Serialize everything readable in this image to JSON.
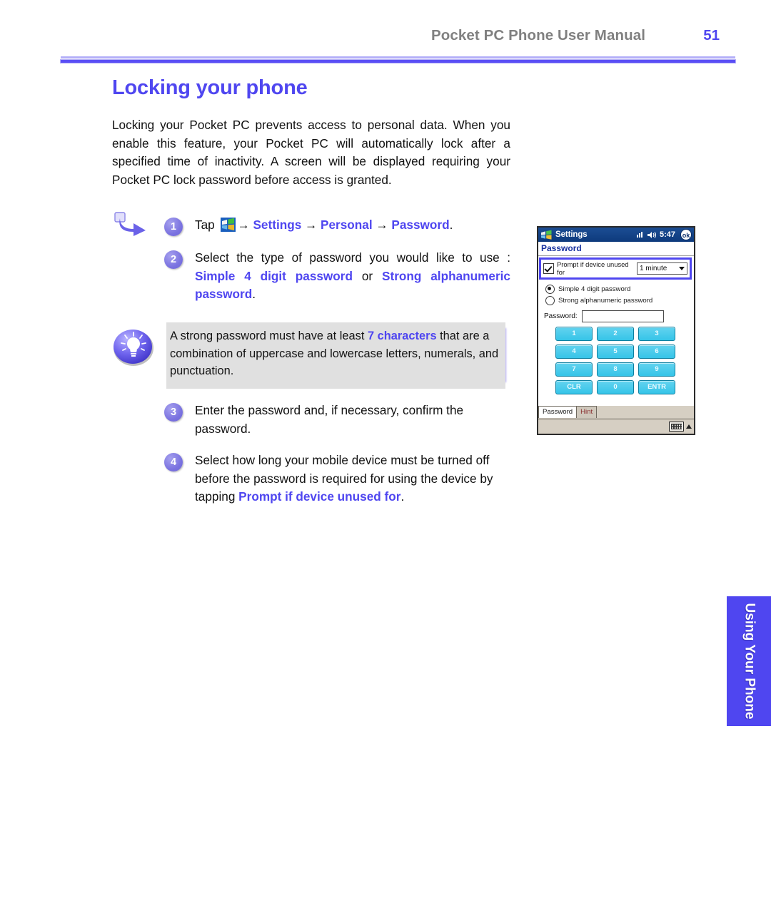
{
  "header": {
    "title": "Pocket PC Phone User Manual",
    "page_number": "51",
    "accent_color": "#4f46f0",
    "title_color": "#808080"
  },
  "document": {
    "title": "Locking your phone",
    "intro": "Locking your Pocket PC prevents access to personal data. When you enable this feature, your Pocket PC will automatically lock after a specified time of inactivity. A screen will be displayed requiring your Pocket PC lock password before access is granted."
  },
  "steps": [
    {
      "number": "1",
      "text_prefix": "Tap ",
      "icon": "windows-start-logo",
      "arrow1": "→ ",
      "link1": "Settings",
      "arrow2": " → ",
      "link2": "Personal",
      "arrow3": " → ",
      "link3": "Password",
      "text_suffix": "."
    },
    {
      "number": "2",
      "text_prefix": "Select the type of password you would like to use : ",
      "link1": "Simple 4 digit password",
      "mid": " or ",
      "link2": "Strong alphanumeric password",
      "text_suffix": "."
    },
    {
      "number": "3",
      "text_prefix": "Enter the password and, if necessary, confirm the password."
    },
    {
      "number": "4",
      "text_prefix": "Select  how long your mobile device must be turned off before the password is required for using the device by tapping ",
      "link1": "Prompt if device unused for",
      "text_suffix": "."
    }
  ],
  "tip": {
    "icon": "lightbulb-icon",
    "text_before": "A strong password must have at least ",
    "highlight": "7 characters",
    "text_after": " that are a combination of uppercase and lowercase letters, numerals, and punctuation.",
    "background_color": "#e0e0e0",
    "shadow_color": "#b0a8f6"
  },
  "pda": {
    "titlebar": {
      "app_name": "Settings",
      "clock": "5:47",
      "ok_label": "ok",
      "icons": [
        "start-logo-icon",
        "connectivity-icon",
        "volume-icon"
      ]
    },
    "subtitle": "Password",
    "prompt_row": {
      "checkbox_checked": true,
      "label": "Prompt if device unused for",
      "dropdown_value": "1 minute",
      "highlight_border_color": "#4f46f0"
    },
    "radios": [
      {
        "label": "Simple 4 digit password",
        "checked": true
      },
      {
        "label": "Strong alphanumeric password",
        "checked": false
      }
    ],
    "password_field": {
      "label": "Password:",
      "value": ""
    },
    "keypad": [
      "1",
      "2",
      "3",
      "4",
      "5",
      "6",
      "7",
      "8",
      "9",
      "CLR",
      "0",
      "ENTR"
    ],
    "tabs": [
      {
        "label": "Password",
        "active": true
      },
      {
        "label": "Hint",
        "active": false
      }
    ],
    "statusbar_icons": [
      "keyboard-icon",
      "input-panel-caret-icon"
    ]
  },
  "side_tab": {
    "label": "Using Your Phone",
    "color": "#4f46f0"
  }
}
